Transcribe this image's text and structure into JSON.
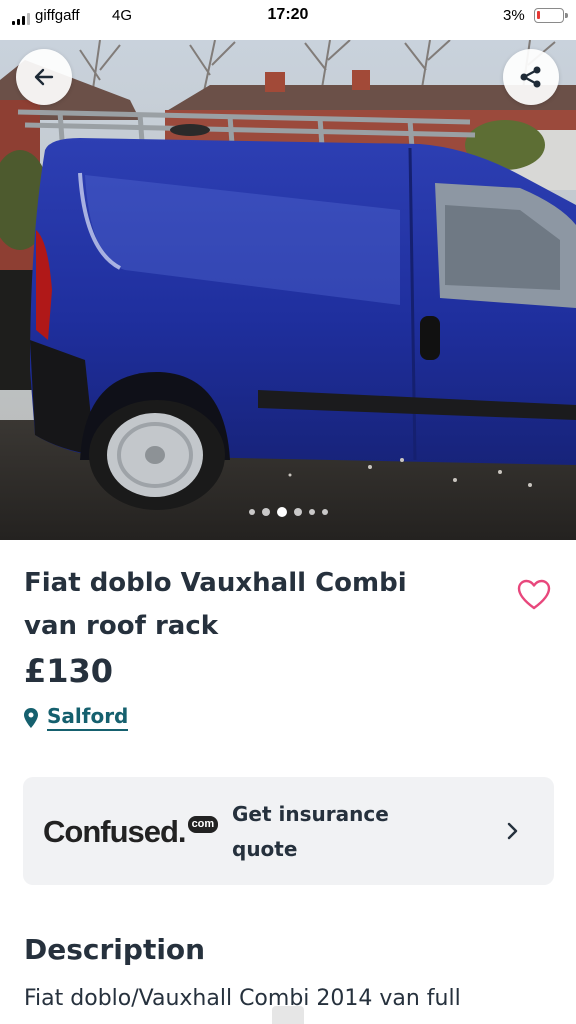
{
  "status_bar": {
    "carrier": "giffgaff",
    "network": "4G",
    "time": "17:20",
    "battery": "3%",
    "battery_level": 0.03,
    "battery_color": "#e53935"
  },
  "gallery": {
    "image_count": 6,
    "active_index": 2,
    "back_icon": "arrow-left-icon",
    "share_icon": "share-icon"
  },
  "listing": {
    "title": "Fiat doblo Vauxhall Combi van roof rack",
    "price": "£130",
    "location": "Salford",
    "location_icon": "map-pin-icon",
    "favourite_icon": "heart-icon",
    "accent_color": "#15606e",
    "heart_color": "#e8477c"
  },
  "insurance": {
    "brand_word": "Confused.",
    "brand_badge": "com",
    "label": "Get insurance quote",
    "chevron_icon": "chevron-right-icon"
  },
  "description": {
    "heading": "Description",
    "text": "Fiat doblo/Vauxhall Combi 2014 van full"
  }
}
